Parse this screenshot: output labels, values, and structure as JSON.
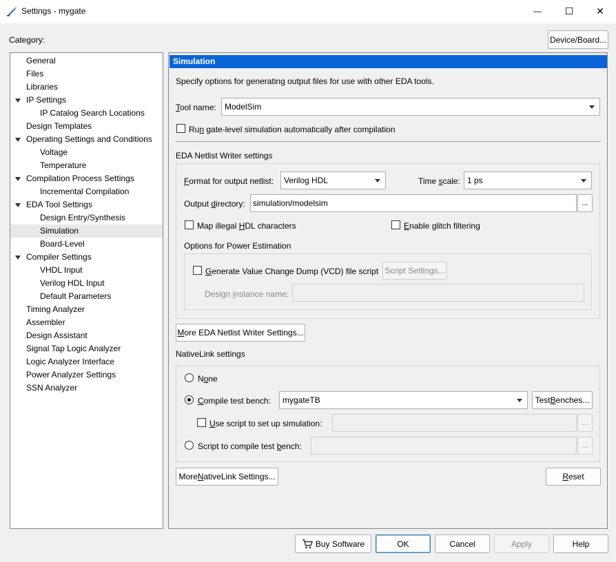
{
  "window": {
    "title": "Settings - mygate",
    "minimize_glyph": "—",
    "maximize_glyph": "☐",
    "close_glyph": "✕"
  },
  "category_label": "Category:",
  "device_board_button": "Device/Board...",
  "tree": [
    {
      "label": "General",
      "level": 0,
      "expandable": false,
      "selected": false
    },
    {
      "label": "Files",
      "level": 0,
      "expandable": false,
      "selected": false
    },
    {
      "label": "Libraries",
      "level": 0,
      "expandable": false,
      "selected": false
    },
    {
      "label": "IP Settings",
      "level": 0,
      "expandable": true,
      "selected": false
    },
    {
      "label": "IP Catalog Search Locations",
      "level": 1,
      "expandable": false,
      "selected": false
    },
    {
      "label": "Design Templates",
      "level": 0,
      "expandable": false,
      "selected": false
    },
    {
      "label": "Operating Settings and Conditions",
      "level": 0,
      "expandable": true,
      "selected": false
    },
    {
      "label": "Voltage",
      "level": 1,
      "expandable": false,
      "selected": false
    },
    {
      "label": "Temperature",
      "level": 1,
      "expandable": false,
      "selected": false
    },
    {
      "label": "Compilation Process Settings",
      "level": 0,
      "expandable": true,
      "selected": false
    },
    {
      "label": "Incremental Compilation",
      "level": 1,
      "expandable": false,
      "selected": false
    },
    {
      "label": "EDA Tool Settings",
      "level": 0,
      "expandable": true,
      "selected": false
    },
    {
      "label": "Design Entry/Synthesis",
      "level": 1,
      "expandable": false,
      "selected": false
    },
    {
      "label": "Simulation",
      "level": 1,
      "expandable": false,
      "selected": true
    },
    {
      "label": "Board-Level",
      "level": 1,
      "expandable": false,
      "selected": false
    },
    {
      "label": "Compiler Settings",
      "level": 0,
      "expandable": true,
      "selected": false
    },
    {
      "label": "VHDL Input",
      "level": 1,
      "expandable": false,
      "selected": false
    },
    {
      "label": "Verilog HDL Input",
      "level": 1,
      "expandable": false,
      "selected": false
    },
    {
      "label": "Default Parameters",
      "level": 1,
      "expandable": false,
      "selected": false
    },
    {
      "label": "Timing Analyzer",
      "level": 0,
      "expandable": false,
      "selected": false
    },
    {
      "label": "Assembler",
      "level": 0,
      "expandable": false,
      "selected": false
    },
    {
      "label": "Design Assistant",
      "level": 0,
      "expandable": false,
      "selected": false
    },
    {
      "label": "Signal Tap Logic Analyzer",
      "level": 0,
      "expandable": false,
      "selected": false
    },
    {
      "label": "Logic Analyzer Interface",
      "level": 0,
      "expandable": false,
      "selected": false
    },
    {
      "label": "Power Analyzer Settings",
      "level": 0,
      "expandable": false,
      "selected": false
    },
    {
      "label": "SSN Analyzer",
      "level": 0,
      "expandable": false,
      "selected": false
    }
  ],
  "panel": {
    "header": "Simulation",
    "description": "Specify options for generating output files for use with other EDA tools.",
    "tool_name": {
      "label_u": "T",
      "label_rest": "ool name:",
      "value": "ModelSim"
    },
    "run_gate": {
      "pre": "Ru",
      "u": "n",
      "rest": " gate-level simulation automatically after compilation",
      "checked": false
    },
    "eda_netlist_title": "EDA Netlist Writer settings",
    "format": {
      "u": "F",
      "rest": "ormat for output netlist:",
      "value": "Verilog HDL"
    },
    "time_scale": {
      "pre": "Time ",
      "u": "s",
      "rest": "cale:",
      "value": "1 ps"
    },
    "output_dir": {
      "pre": "Output ",
      "u": "d",
      "rest": "irectory:",
      "value": "simulation/modelsim",
      "browse": "..."
    },
    "map_illegal": {
      "pre": "Map illegal ",
      "u": "H",
      "rest": "DL characters",
      "checked": false
    },
    "glitch": {
      "u": "E",
      "rest": "nable glitch filtering",
      "checked": false
    },
    "power_title": "Options for Power Estimation",
    "vcd": {
      "u": "G",
      "rest": "enerate Value Change Dump (VCD) file script",
      "checked": false
    },
    "script_settings": "Script Settings...",
    "design_instance": {
      "pre": "Design ",
      "u": "i",
      "rest": "nstance name:",
      "value": ""
    },
    "more_eda": {
      "u": "M",
      "rest": "ore EDA Netlist Writer Settings..."
    },
    "nativelink_title": "NativeLink settings",
    "none": {
      "pre": "N",
      "u": "o",
      "rest": "ne",
      "selected": false
    },
    "compile_tb": {
      "u": "C",
      "rest": "ompile test bench:",
      "value": "mygateTB",
      "selected": true
    },
    "test_benches": {
      "pre": "Test ",
      "u": "B",
      "rest": "enches..."
    },
    "use_script": {
      "u": "U",
      "rest": "se script to set up simulation:",
      "value": "",
      "checked": false,
      "browse": "..."
    },
    "script_compile": {
      "pre": "Script to compile test ",
      "u": "b",
      "rest": "ench:",
      "value": "",
      "selected": false,
      "browse": "..."
    },
    "more_nativelink": {
      "pre": "More ",
      "u": "N",
      "rest": "ativeLink Settings..."
    },
    "reset": {
      "u": "R",
      "rest": "eset"
    }
  },
  "footer": {
    "buy_software": "Buy Software",
    "ok": "OK",
    "cancel": "Cancel",
    "apply": "Apply",
    "help": "Help"
  },
  "colors": {
    "header": "#0a64d8",
    "selected_row": "#e8e8e8"
  }
}
